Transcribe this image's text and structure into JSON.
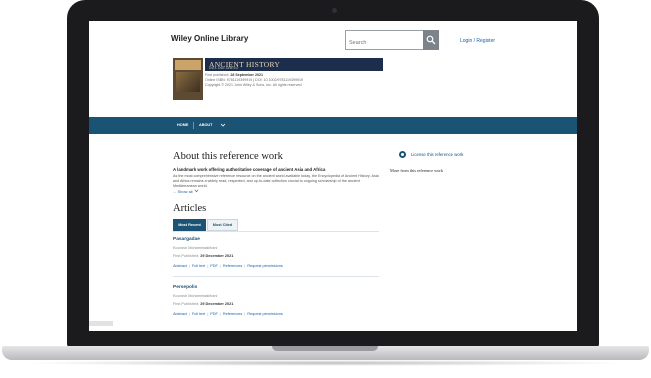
{
  "header": {
    "logo": "Wiley Online Library",
    "search_placeholder": "Search",
    "login": "Login / Register"
  },
  "book": {
    "title": "ANCIENT HISTORY",
    "subtitle": "ASIA AND AFRICA",
    "published_label": "First published:",
    "published_date": "28 September 2021",
    "isbn_line": "Online ISBN: 9781119399919 | DOI: 10.1002/9781119399919",
    "copyright": "Copyright © 2021 John Wiley & Sons, Inc. All rights reserved."
  },
  "nav": {
    "home": "HOME",
    "about": "ABOUT"
  },
  "about": {
    "title": "About this reference work",
    "lead": "A landmark work offering authoritative coverage of ancient Asia and Africa",
    "description": "As the most comprehensive reference resource on the ancient world available today, the Encyclopedia of Ancient History: Asia and Africa remains a widely read, respected, and up-to-date collection crucial to ongoing scholarship of the ancient Mediterranean world.",
    "show_all": "... Show all"
  },
  "articles": {
    "title": "Articles",
    "tabs": [
      {
        "label": "Most Recent"
      },
      {
        "label": "Most Cited"
      }
    ],
    "items": [
      {
        "title": "Pasargadae",
        "author": "Kourosh Mohammadkhani",
        "date_label": "First Published:",
        "date": "29 December 2021",
        "links": [
          "Abstract",
          "Full text",
          "PDF",
          "References",
          "Request permissions"
        ]
      },
      {
        "title": "Persepolis",
        "author": "Kourosh Mohammadkhani",
        "date_label": "First Published:",
        "date": "29 December 2021",
        "links": [
          "Abstract",
          "Full text",
          "PDF",
          "References",
          "Request permissions"
        ]
      }
    ]
  },
  "sidebar": {
    "license": "License this reference work",
    "more": "More from this reference work"
  },
  "colors": {
    "nav_bg": "#1b5374",
    "link": "#1d5fa8",
    "banner_bg": "#1d2e4c"
  }
}
